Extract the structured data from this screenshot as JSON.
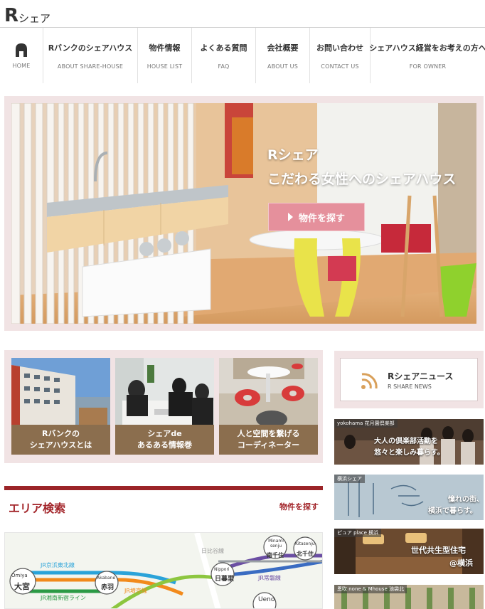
{
  "logo": {
    "big": "R",
    "small": "シェア"
  },
  "nav": [
    {
      "jp": "",
      "en": "HOME"
    },
    {
      "jp": "Rバンクのシェアハウス",
      "en": "ABOUT SHARE-HOUSE"
    },
    {
      "jp": "物件情報",
      "en": "HOUSE LIST"
    },
    {
      "jp": "よくある質問",
      "en": "FAQ"
    },
    {
      "jp": "会社概要",
      "en": "ABOUT US"
    },
    {
      "jp": "お問い合わせ",
      "en": "CONTACT US"
    },
    {
      "jp": "シェアハウス経営をお考えの方へ",
      "en": "FOR OWNER"
    }
  ],
  "hero": {
    "line1": "Rシェア",
    "line2": "こだわる女性へのシェアハウス",
    "button": "物件を探す"
  },
  "cards": [
    {
      "line1": "Rバンクの",
      "line2": "シェアハウスとは"
    },
    {
      "line1": "シェアde",
      "line2": "あるある情報巻"
    },
    {
      "line1": "人と空間を繋げる",
      "line2": "コーディネーター"
    }
  ],
  "area": {
    "title": "エリア検索",
    "link": "物件を探す"
  },
  "map": {
    "stations": [
      {
        "en": "Omiya",
        "jp": "大宮"
      },
      {
        "en": "Akabane",
        "jp": "赤羽"
      },
      {
        "en": "Nippori",
        "jp": "日暮里"
      },
      {
        "en": "Minami senju",
        "jp": "南千住"
      },
      {
        "en": "Kitasenju",
        "jp": "北千住"
      },
      {
        "en": "Ueno",
        "jp": ""
      }
    ],
    "lines": [
      "JR京浜東北線",
      "JR湘南新宿ライン",
      "JR埼京線",
      "JR常磐線",
      "日比谷線"
    ]
  },
  "news": {
    "jp": "Rシェアニュース",
    "en": "R SHARE NEWS"
  },
  "banners": [
    {
      "tag": "yokohama 花月園倶楽部",
      "text1": "大人の倶楽部活動を",
      "text2": "悠々と楽しみ暮らす。"
    },
    {
      "tag": "横浜シェア",
      "text1": "憧れの街、",
      "text2": "横浜で暮らす。"
    },
    {
      "tag": "ピュア place 横浜",
      "text1": "世代共生型住宅",
      "text2": "@横浜"
    },
    {
      "tag": "恩吹 none & Mhouse 池袋北",
      "text1": "",
      "text2": ""
    }
  ],
  "colors": {
    "accent": "#a3262b",
    "pink_frame": "#f1e3e4",
    "card_caption": "#8b6e4e",
    "hero_button": "#e5909c"
  }
}
